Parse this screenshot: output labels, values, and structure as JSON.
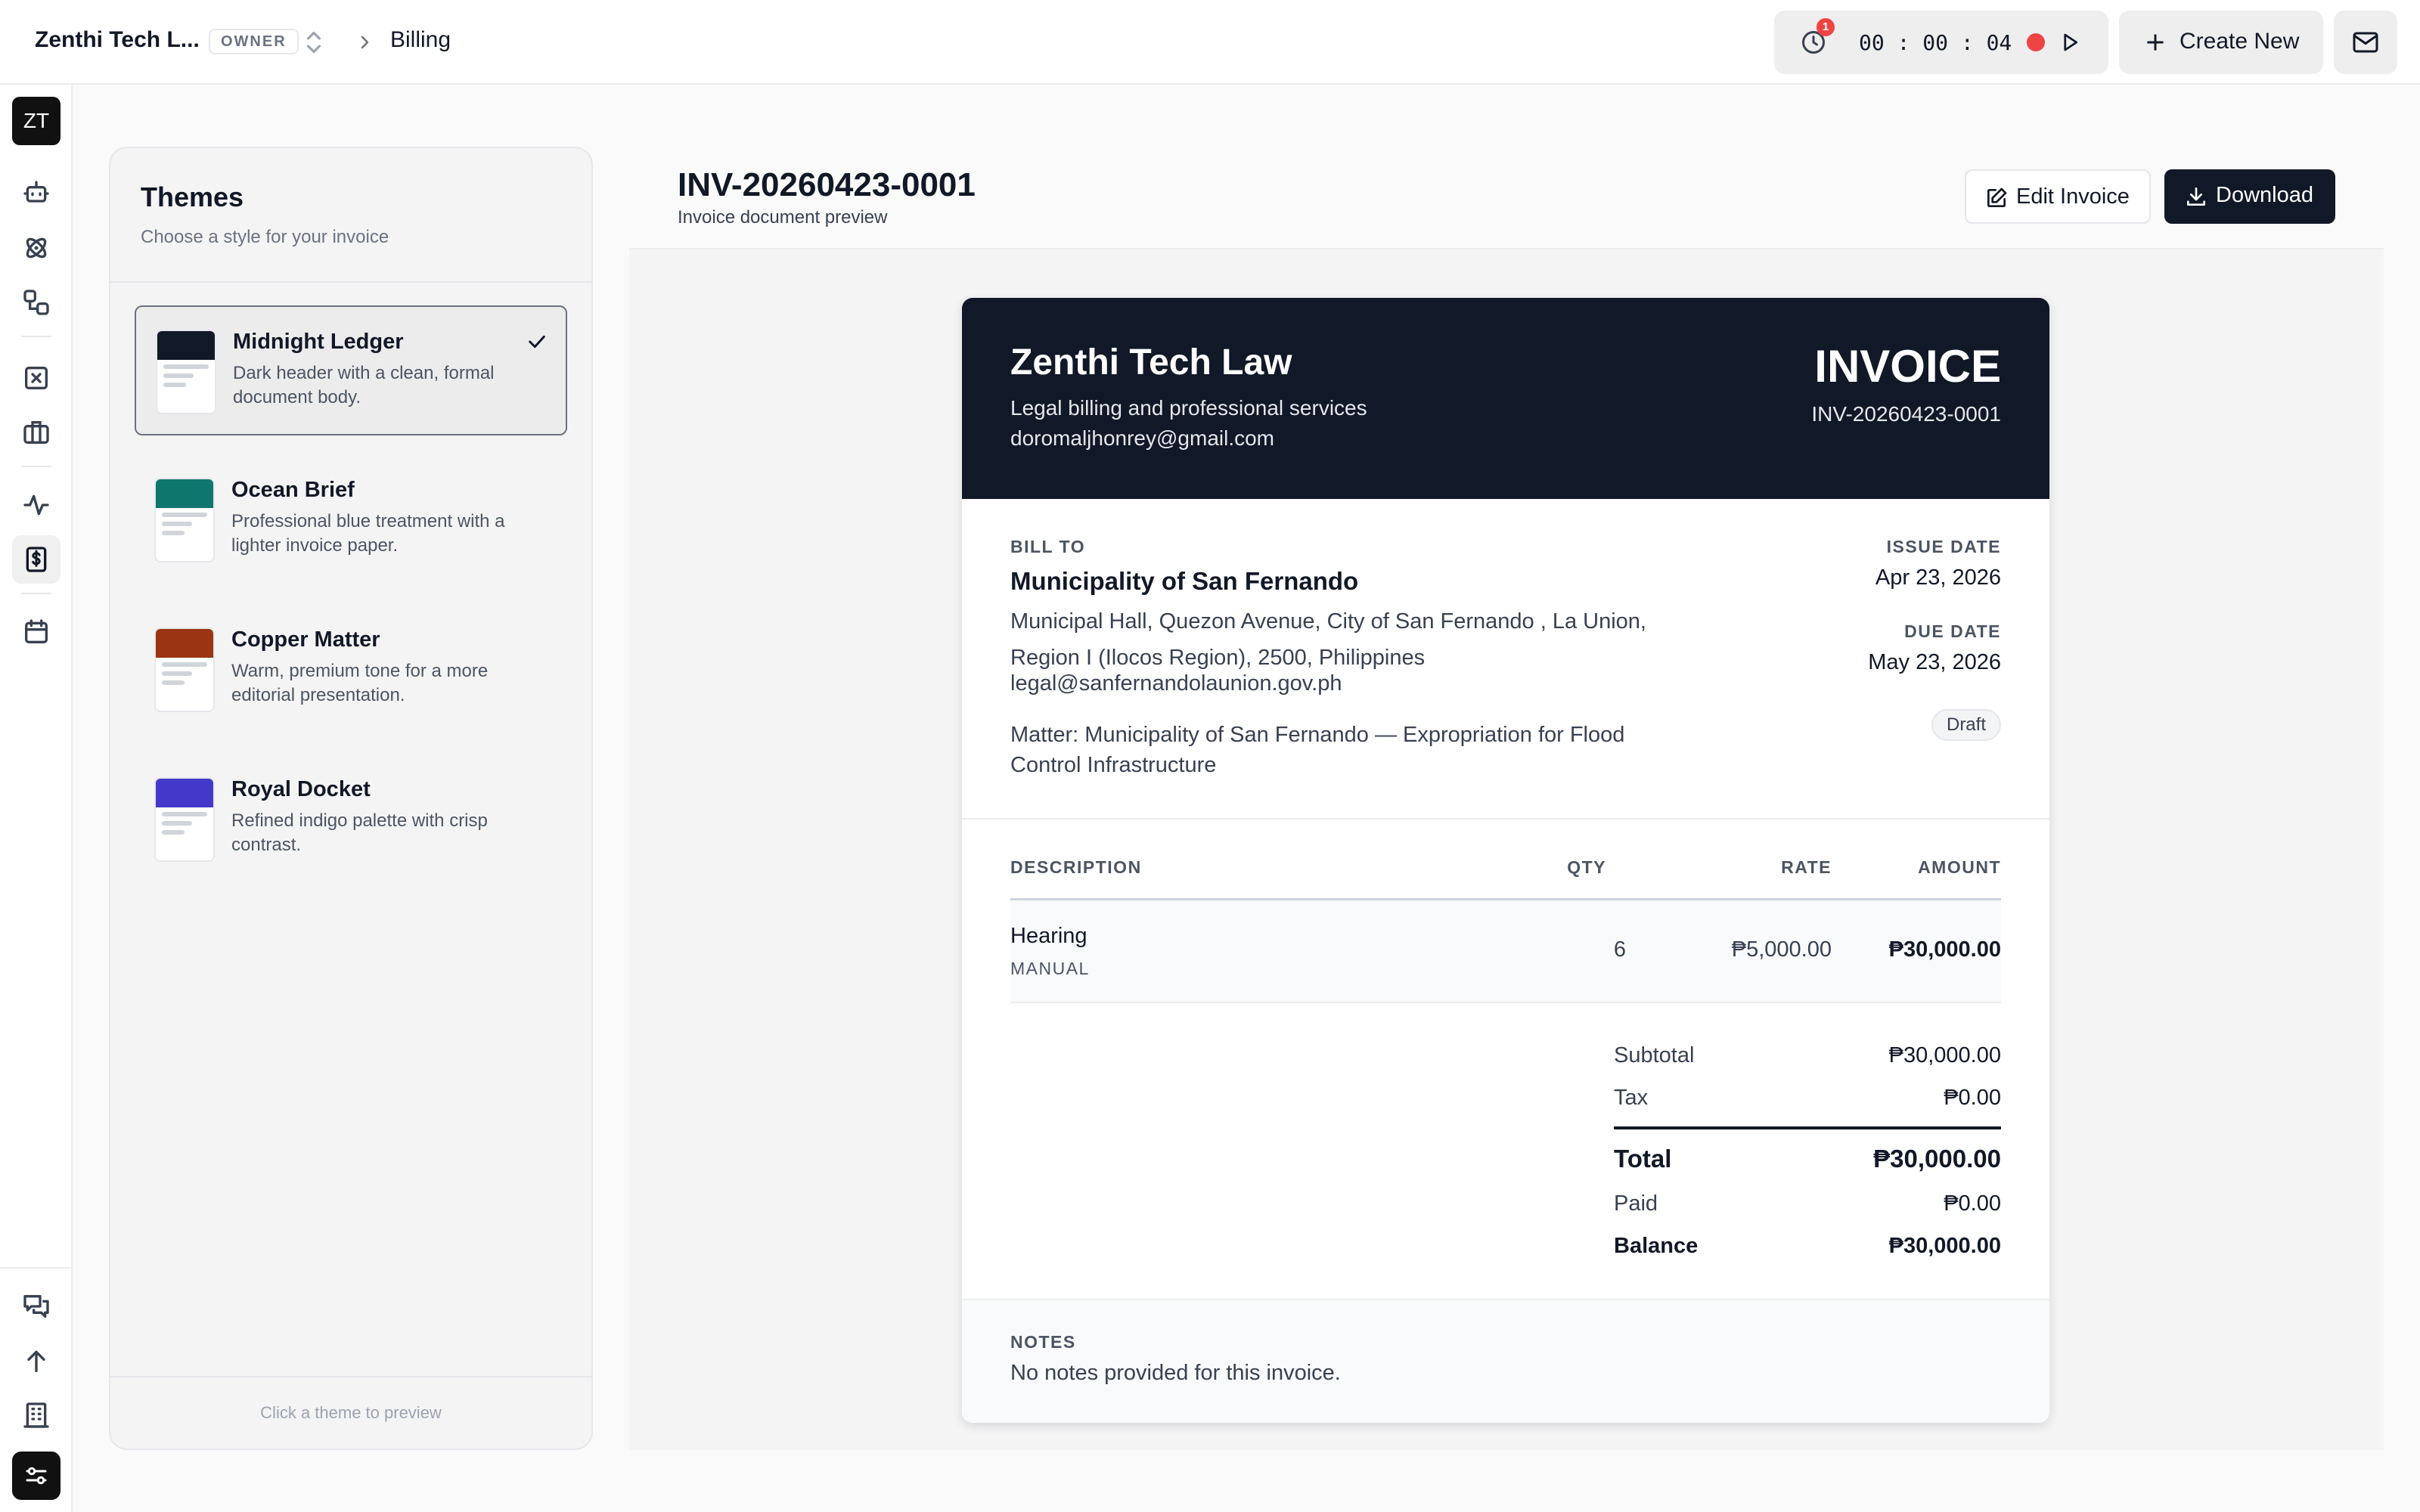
{
  "topbar": {
    "org_name": "Zenthi Tech L...",
    "role": "OWNER",
    "breadcrumb": "Billing",
    "timer": {
      "notification_count": "1",
      "elapsed": "00 : 00 : 04",
      "recording_color": "#ef4444"
    },
    "create_label": "Create New"
  },
  "rail": {
    "logo_text": "ZT",
    "icons": [
      "robot-icon",
      "atom-icon",
      "workflow-icon",
      "square-x-icon",
      "briefcase-icon",
      "activity-icon",
      "invoice-dollar-icon",
      "calendar-icon",
      "messages-icon",
      "arrow-up-icon",
      "building-icon",
      "settings-toggle-icon"
    ],
    "active": "invoice-dollar-icon"
  },
  "themes": {
    "title": "Themes",
    "subtitle": "Choose a style for your invoice",
    "items": [
      {
        "name": "Midnight Ledger",
        "description": "Dark header with a clean, formal document body.",
        "color": "#111827",
        "selected": true
      },
      {
        "name": "Ocean Brief",
        "description": "Professional blue treatment with a lighter invoice paper.",
        "color": "#0f766e",
        "selected": false
      },
      {
        "name": "Copper Matter",
        "description": "Warm, premium tone for a more editorial presentation.",
        "color": "#9a3412",
        "selected": false
      },
      {
        "name": "Royal Docket",
        "description": "Refined indigo palette with crisp contrast.",
        "color": "#4338ca",
        "selected": false
      }
    ],
    "footer": "Click a theme to preview"
  },
  "main": {
    "title": "INV-20260423-0001",
    "subtitle": "Invoice document preview",
    "edit_label": "Edit Invoice",
    "download_label": "Download"
  },
  "invoice": {
    "firm_name": "Zenthi Tech Law",
    "firm_tagline": "Legal billing and professional services",
    "firm_email": "doromaljhonrey@gmail.com",
    "heading": "INVOICE",
    "number": "INV-20260423-0001",
    "bill_to_label": "BILL TO",
    "client_name": "Municipality of San Fernando",
    "client_address": "Municipal Hall, Quezon Avenue, City of San Fernando , La Union, Region I (Ilocos Region), 2500, Philippines",
    "client_email": "legal@sanfernandolaunion.gov.ph",
    "matter": "Matter: Municipality of San Fernando — Expropriation for Flood Control Infrastructure",
    "issue_date_label": "ISSUE DATE",
    "issue_date": "Apr 23, 2026",
    "due_date_label": "DUE DATE",
    "due_date": "May 23, 2026",
    "status": "Draft",
    "columns": {
      "description": "DESCRIPTION",
      "qty": "QTY",
      "rate": "RATE",
      "amount": "AMOUNT"
    },
    "items": [
      {
        "description": "Hearing",
        "type": "MANUAL",
        "qty": "6",
        "rate": "₱5,000.00",
        "amount": "₱30,000.00"
      }
    ],
    "totals": {
      "subtotal_label": "Subtotal",
      "subtotal": "₱30,000.00",
      "tax_label": "Tax",
      "tax": "₱0.00",
      "total_label": "Total",
      "total": "₱30,000.00",
      "paid_label": "Paid",
      "paid": "₱0.00",
      "balance_label": "Balance",
      "balance": "₱30,000.00"
    },
    "notes_label": "NOTES",
    "notes": "No notes provided for this invoice."
  }
}
